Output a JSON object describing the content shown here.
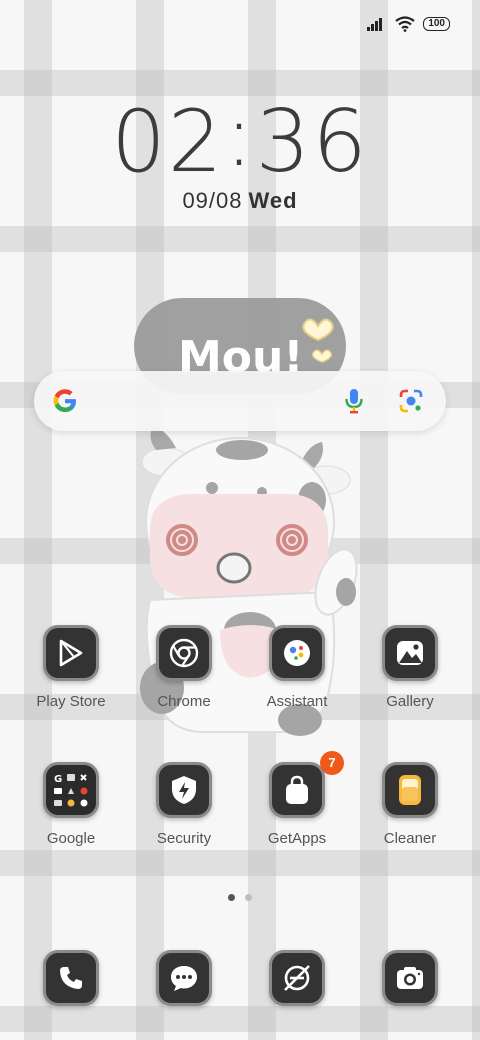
{
  "status": {
    "battery": "100"
  },
  "clock": {
    "hours": "02",
    "separator": ":",
    "minutes": "36"
  },
  "date": {
    "date": "09/08",
    "day": "Wed"
  },
  "wallpaper": {
    "bubble_text": "Mou!"
  },
  "search": {
    "provider_icon": "google-g-icon",
    "mic_icon": "mic-icon",
    "lens_icon": "lens-icon"
  },
  "apps_row1": [
    {
      "label": "Play Store",
      "icon": "play-store-icon"
    },
    {
      "label": "Chrome",
      "icon": "chrome-icon"
    },
    {
      "label": "Assistant",
      "icon": "assistant-icon"
    },
    {
      "label": "Gallery",
      "icon": "gallery-icon"
    }
  ],
  "apps_row2": [
    {
      "label": "Google",
      "icon": "google-folder-icon"
    },
    {
      "label": "Security",
      "icon": "security-icon"
    },
    {
      "label": "GetApps",
      "icon": "getapps-icon",
      "badge": "7"
    },
    {
      "label": "Cleaner",
      "icon": "cleaner-icon"
    }
  ],
  "dock": [
    {
      "icon": "phone-icon"
    },
    {
      "icon": "messages-icon"
    },
    {
      "icon": "browser-icon"
    },
    {
      "icon": "camera-icon"
    }
  ],
  "colors": {
    "badge": "#ef5a1a",
    "icon_bg": "#333333",
    "cleaner_accent": "#f6b73c"
  }
}
